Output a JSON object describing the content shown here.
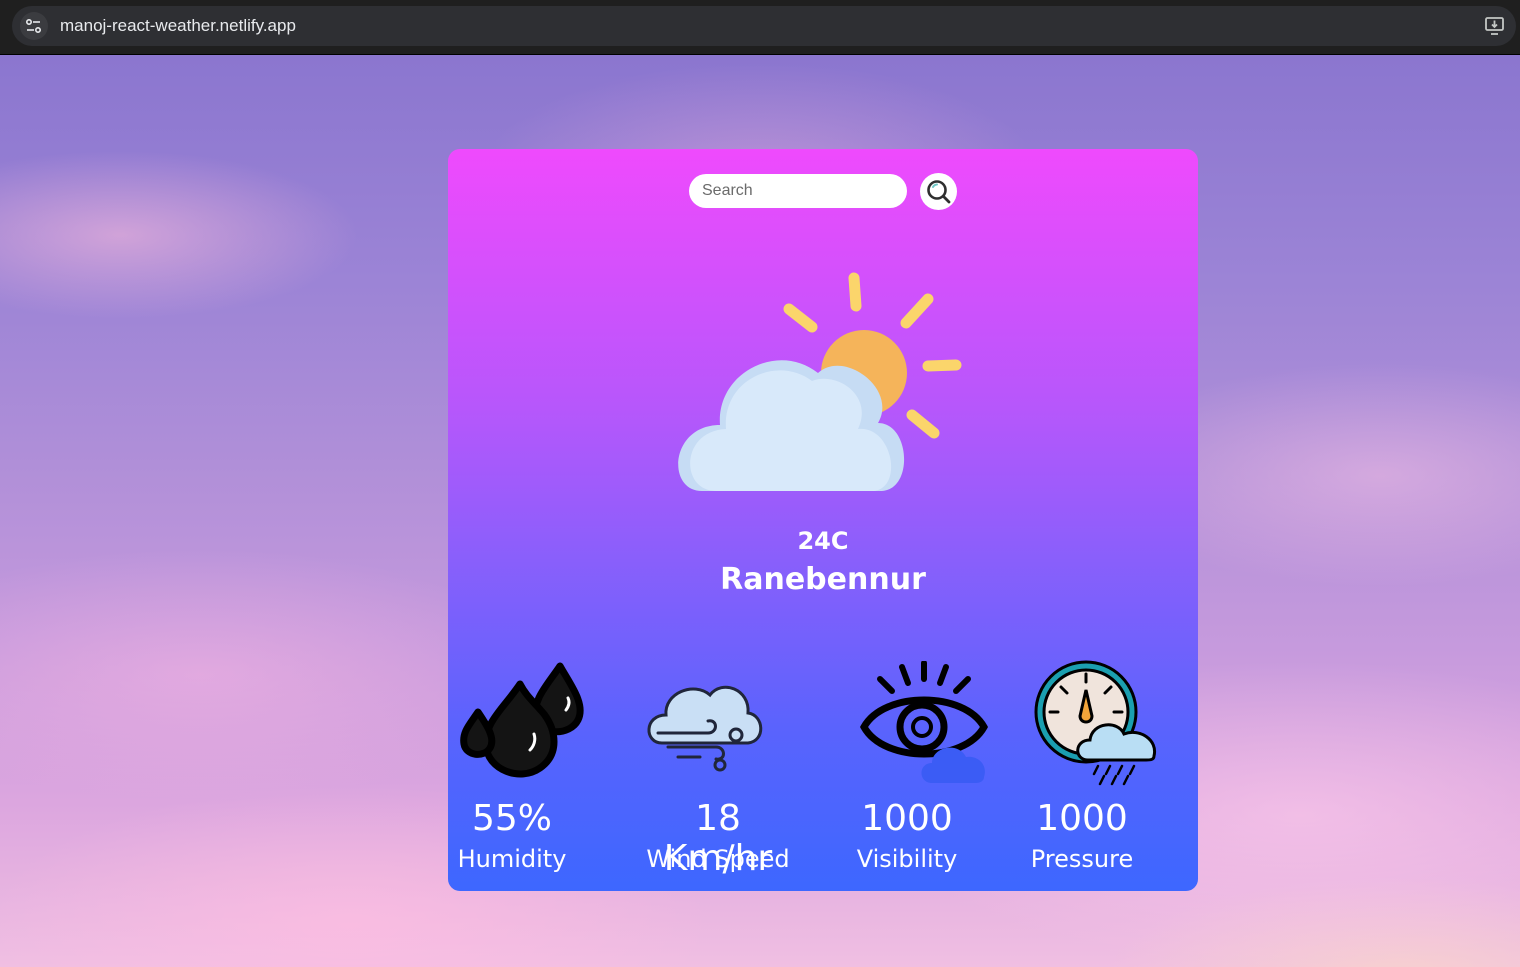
{
  "browser": {
    "url": "manoj-react-weather.netlify.app"
  },
  "search": {
    "placeholder": "Search"
  },
  "weather": {
    "temperature": "24C",
    "city": "Ranebennur",
    "icon": "partly-cloudy-icon"
  },
  "metrics": [
    {
      "value": "55%",
      "label": "Humidity",
      "icon": "humidity-drops-icon"
    },
    {
      "value": "18 Km/hr",
      "label": "Wind Speed",
      "icon": "wind-cloud-icon"
    },
    {
      "value": "1000",
      "label": "Visibility",
      "icon": "eye-cloud-icon"
    },
    {
      "value": "1000",
      "label": "Pressure",
      "icon": "barometer-rain-icon"
    }
  ],
  "colors": {
    "card_top": "#ef4afd",
    "card_bottom": "#3d67ff",
    "sun": "#f5b45a",
    "sun_rays": "#fbd56b",
    "cloud": "#d6e8fa"
  }
}
